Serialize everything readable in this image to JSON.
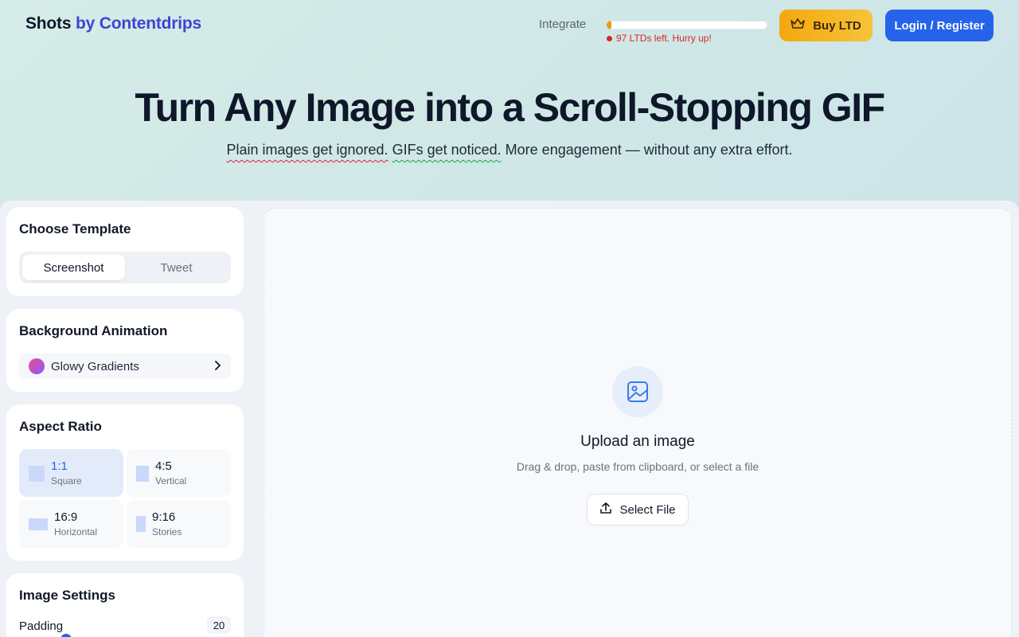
{
  "header": {
    "brand_primary": "Shots",
    "brand_secondary": "by Contentdrips",
    "integrate_label": "Integrate",
    "ltd_progress_fraction": 0.03,
    "ltd_note": "97 LTDs left. Hurry up!",
    "buy_button": "Buy LTD",
    "login_button": "Login / Register",
    "colors": {
      "brand_accent": "#3b45d1",
      "buy": "#f5a70e",
      "login": "#2563eb",
      "alert": "#dc2626"
    }
  },
  "hero": {
    "title": "Turn Any Image into a Scroll-Stopping GIF",
    "sub_part1": "Plain images get ignored.",
    "sub_part2": "GIFs get noticed.",
    "sub_part3": "More engagement — without any extra effort."
  },
  "sidebar": {
    "template": {
      "title": "Choose Template",
      "options": [
        "Screenshot",
        "Tweet"
      ],
      "selected": "Screenshot"
    },
    "background": {
      "title": "Background Animation",
      "selected": "Glowy Gradients"
    },
    "aspect": {
      "title": "Aspect Ratio",
      "options": [
        {
          "ratio": "1:1",
          "name": "Square"
        },
        {
          "ratio": "4:5",
          "name": "Vertical"
        },
        {
          "ratio": "16:9",
          "name": "Horizontal"
        },
        {
          "ratio": "9:16",
          "name": "Stories"
        }
      ],
      "selected": "1:1"
    },
    "image_settings": {
      "title": "Image Settings",
      "padding_label": "Padding",
      "padding_value": "20"
    }
  },
  "upload": {
    "title": "Upload an image",
    "subtitle": "Drag & drop, paste from clipboard, or select a file",
    "button": "Select File",
    "icon": "image-icon"
  }
}
